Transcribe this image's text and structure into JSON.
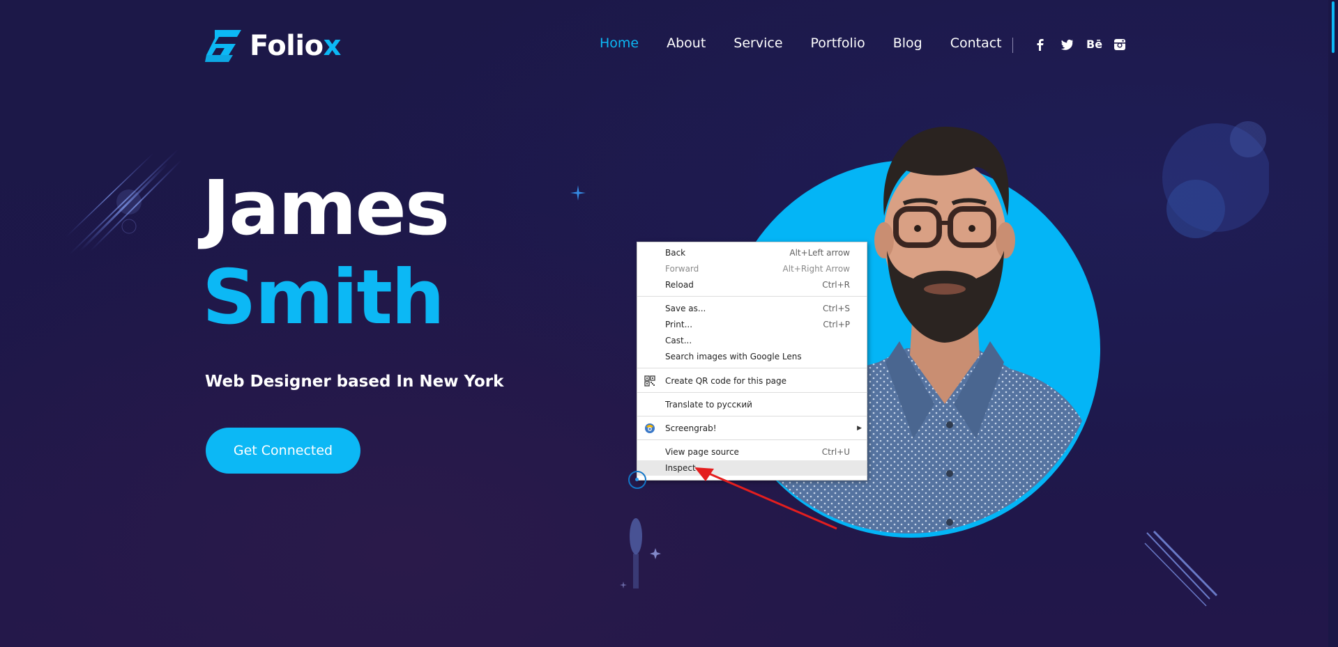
{
  "logo": {
    "text_main": "Folio",
    "text_accent": "x"
  },
  "nav": [
    {
      "label": "Home",
      "active": true
    },
    {
      "label": "About",
      "active": false
    },
    {
      "label": "Service",
      "active": false
    },
    {
      "label": "Portfolio",
      "active": false
    },
    {
      "label": "Blog",
      "active": false
    },
    {
      "label": "Contact",
      "active": false
    }
  ],
  "social": [
    {
      "icon": "facebook-icon",
      "glyph": "f"
    },
    {
      "icon": "twitter-icon",
      "glyph": "t"
    },
    {
      "icon": "behance-icon",
      "glyph": "Bē"
    },
    {
      "icon": "instagram-icon",
      "glyph": "◎"
    }
  ],
  "hero": {
    "first_name": "James",
    "last_name": "Smith",
    "subtitle": "Web Designer based In New York",
    "cta_label": "Get Connected"
  },
  "context_menu": {
    "back": {
      "label": "Back",
      "shortcut": "Alt+Left arrow"
    },
    "forward": {
      "label": "Forward",
      "shortcut": "Alt+Right Arrow"
    },
    "reload": {
      "label": "Reload",
      "shortcut": "Ctrl+R"
    },
    "save_as": {
      "label": "Save as...",
      "shortcut": "Ctrl+S"
    },
    "print": {
      "label": "Print...",
      "shortcut": "Ctrl+P"
    },
    "cast": {
      "label": "Cast..."
    },
    "lens": {
      "label": "Search images with Google Lens"
    },
    "qr": {
      "label": "Create QR code for this page"
    },
    "translate": {
      "label": "Translate to русский"
    },
    "screengrab": {
      "label": "Screengrab!"
    },
    "view_source": {
      "label": "View page source",
      "shortcut": "Ctrl+U"
    },
    "inspect": {
      "label": "Inspect"
    }
  },
  "colors": {
    "accent": "#0cb8f5",
    "background": "#1c1848",
    "circle": "#04b5f6",
    "annotation_arrow": "#e41e1e"
  }
}
